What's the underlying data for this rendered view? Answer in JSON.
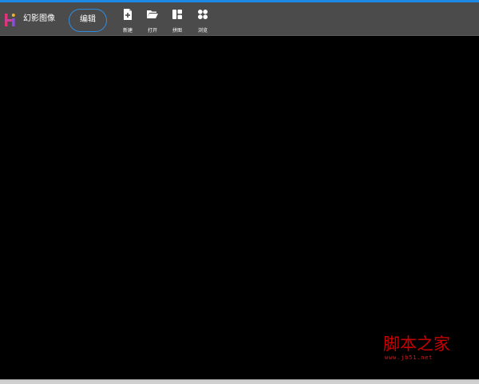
{
  "app": {
    "title": "幻影图像",
    "logo_colors": {
      "left": "#e0337a",
      "right": "#8a4be0",
      "dot": "#f0b028"
    }
  },
  "toolbar": {
    "edit_label": "编辑",
    "tools": [
      {
        "label": "新建",
        "icon": "new-file-icon"
      },
      {
        "label": "打开",
        "icon": "open-folder-icon"
      },
      {
        "label": "拼图",
        "icon": "collage-icon"
      },
      {
        "label": "浏览",
        "icon": "browse-icon"
      }
    ]
  },
  "watermark": {
    "main_text": "脚本之家",
    "url_text": "www.jb51.net",
    "color": "#c80000"
  },
  "colors": {
    "toolbar_bg": "#4b4b4b",
    "canvas_bg": "#000000",
    "accent": "#2f8ddf",
    "top_stripe": "#1e88e5"
  }
}
